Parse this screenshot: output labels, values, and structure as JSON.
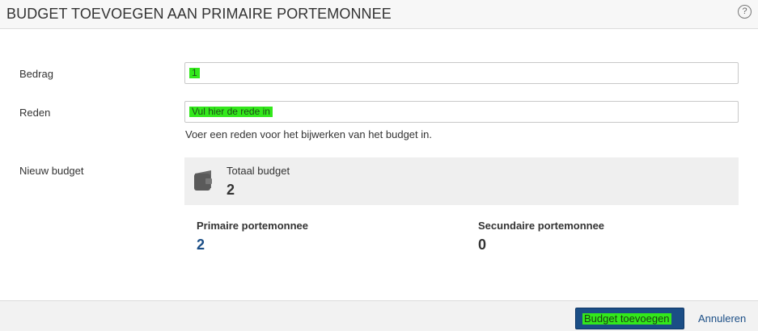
{
  "dialog": {
    "title": "BUDGET TOEVOEGEN AAN PRIMAIRE PORTEMONNEE",
    "help_icon": "?"
  },
  "form": {
    "amount": {
      "label": "Bedrag",
      "value": "1"
    },
    "reason": {
      "label": "Reden",
      "value": "Vul hier de rede in",
      "help": "Voer een reden voor het bijwerken van het budget in."
    },
    "new_budget": {
      "label": "Nieuw budget",
      "total_label": "Totaal budget",
      "total_value": "2",
      "primary_label": "Primaire portemonnee",
      "primary_value": "2",
      "secondary_label": "Secundaire portemonnee",
      "secondary_value": "0"
    }
  },
  "footer": {
    "submit_label": "Budget toevoegen",
    "cancel_label": "Annuleren"
  },
  "icons": {
    "help": "help-circle-icon",
    "wallet": "wallet-icon"
  },
  "colors": {
    "accent": "#1b4e86",
    "highlight": "#33e81c"
  }
}
